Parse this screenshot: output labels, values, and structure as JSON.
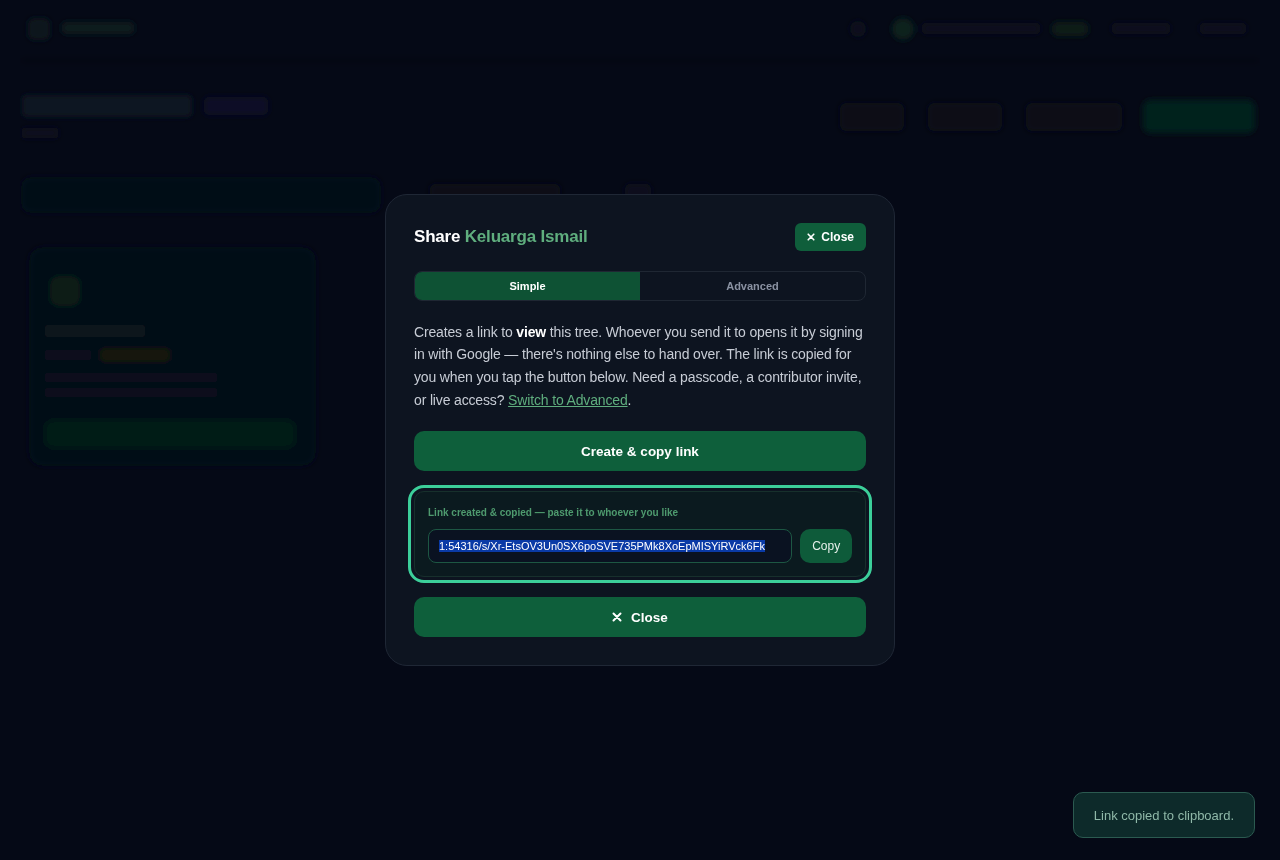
{
  "dialog": {
    "title": "Share",
    "tree_name": "Keluarga Ismail",
    "close_button": {
      "label": "Close"
    },
    "tabs": [
      {
        "label": "Simple",
        "selected": true
      },
      {
        "label": "Advanced",
        "selected": false
      }
    ],
    "description": "Creates a link to **view** this tree. Whoever you send it to opens it by signing in with Google — there's nothing else to hand over. The link is copied for you when you tap the button below. Need a passcode, a contributor invite, or live access?",
    "description_link": "Switch to Advanced",
    "description_end": ".",
    "create_button": {
      "label": "Create & copy link"
    },
    "link_result": {
      "focused": true,
      "label": "Link created & copied — paste it to whoever you like",
      "value": "1:54316/s/Xr-EtsOV3Un0SX6poSVE735PMk8XoEpMISYiRVck6Fk",
      "text_selected": true,
      "copy_button": {
        "label": "Copy"
      }
    },
    "footer_close_button": {
      "label": "Close"
    }
  },
  "toast": {
    "message": "Link copied to clipboard."
  }
}
